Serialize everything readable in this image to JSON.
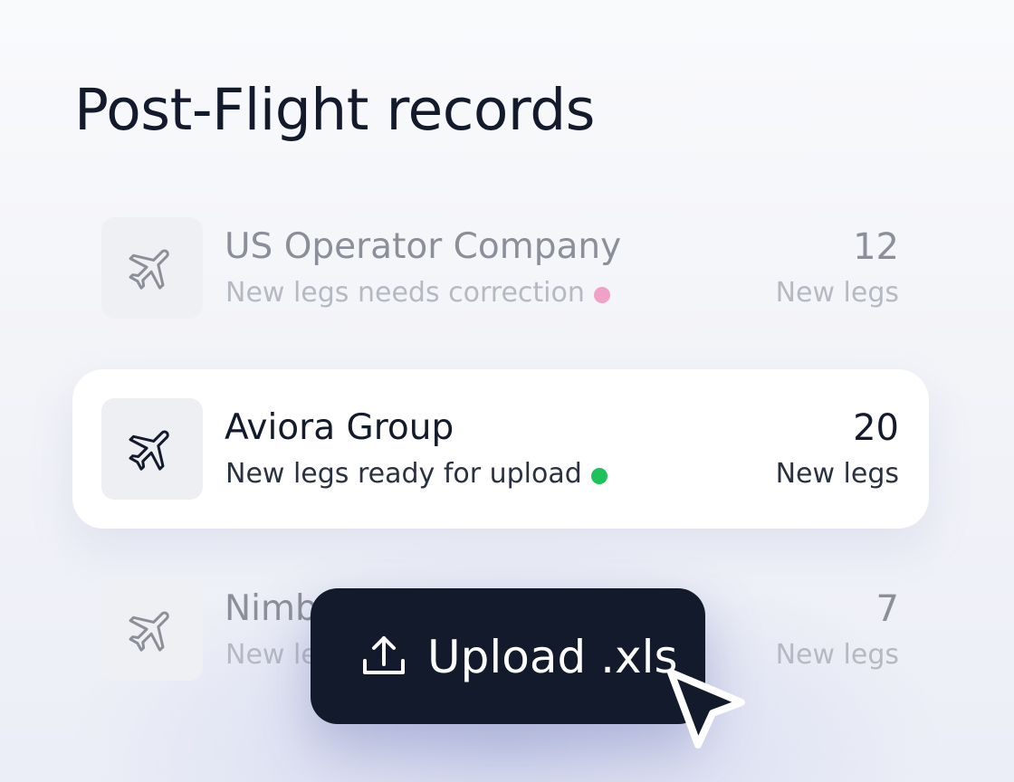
{
  "page": {
    "title": "Post-Flight records"
  },
  "records": [
    {
      "company": "US Operator Company",
      "status": "New legs needs correction",
      "status_color": "#f2a0c8",
      "count": "12",
      "unit": "New legs",
      "icon": "airplane-icon"
    },
    {
      "company": "Aviora Group",
      "status": "New legs ready for upload",
      "status_color": "#1fc25a",
      "count": "20",
      "unit": "New legs",
      "icon": "airplane-icon"
    },
    {
      "company": "Nimb",
      "status": "New le",
      "count": "7",
      "unit": "New legs",
      "icon": "airplane-icon"
    }
  ],
  "upload": {
    "label": "Upload .xls",
    "icon": "upload-icon"
  },
  "cursor": {
    "icon": "cursor-arrow-icon"
  },
  "colors": {
    "text_primary": "#121a2b",
    "text_muted": "#8c8f99",
    "button_bg": "#131a2b",
    "highlight_bg": "#ffffff"
  }
}
